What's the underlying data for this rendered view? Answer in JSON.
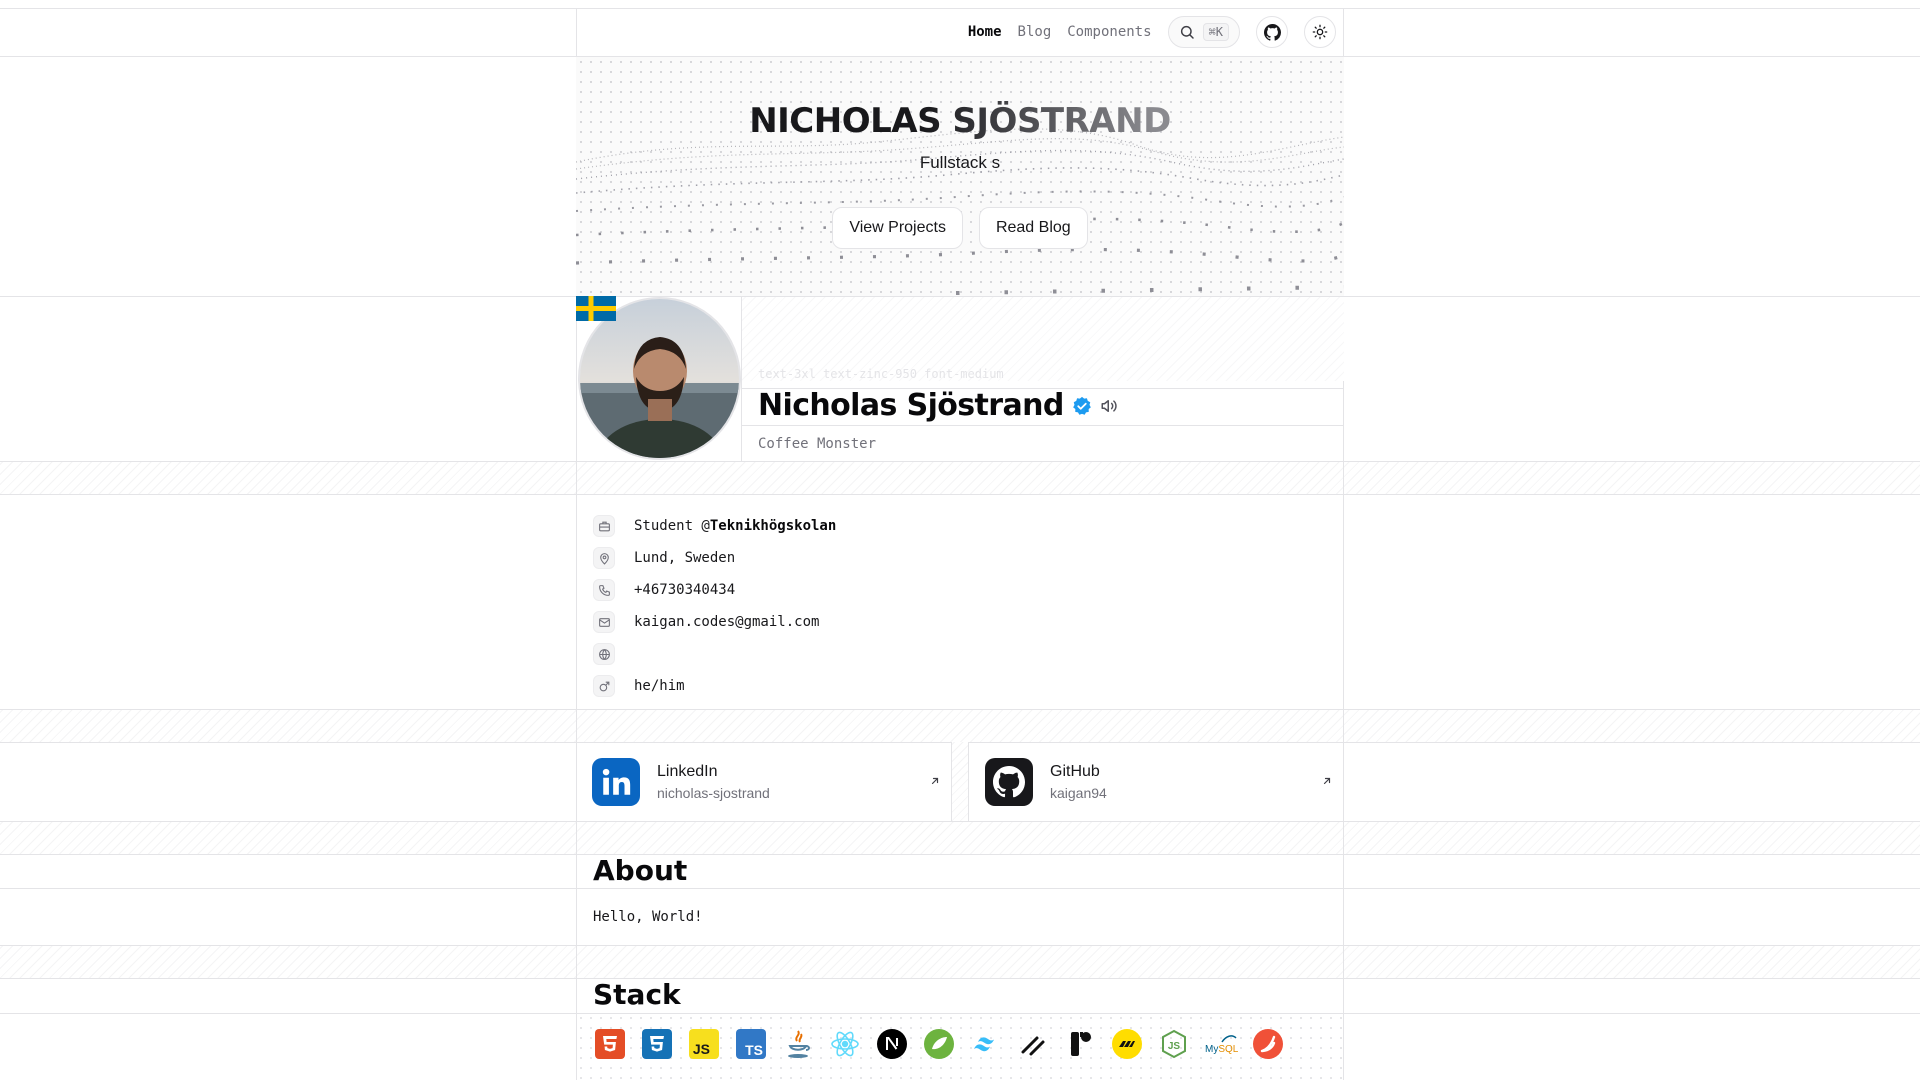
{
  "nav": {
    "links": [
      {
        "label": "Home",
        "active": true
      },
      {
        "label": "Blog",
        "active": false
      },
      {
        "label": "Components",
        "active": false
      }
    ],
    "search_shortcut": "⌘K"
  },
  "hero": {
    "title": "NICHOLAS SJÖSTRAND",
    "subtitle": "Fullstack s",
    "buttons": [
      "View Projects",
      "Read Blog"
    ]
  },
  "profile": {
    "ghost_classes": "text-3xl text-zinc-950 font-medium",
    "name": "Nicholas Sjöstrand",
    "tagline": "Coffee Monster",
    "flag": "sweden-flag"
  },
  "info": {
    "job_prefix": "Student @",
    "job_org": "Teknikhögskolan",
    "location": "Lund, Sweden",
    "phone": "+46730340434",
    "email": "kaigan.codes@gmail.com",
    "website": "",
    "pronouns": "he/him"
  },
  "social": [
    {
      "title": "LinkedIn",
      "handle": "nicholas-sjostrand",
      "icon": "linkedin-icon",
      "color": "#0a66c2"
    },
    {
      "title": "GitHub",
      "handle": "kaigan94",
      "icon": "github-icon",
      "color": "#18181b"
    }
  ],
  "about": {
    "heading": "About",
    "body": "Hello, World!"
  },
  "stack": {
    "heading": "Stack",
    "items": [
      "HTML5",
      "CSS3",
      "JavaScript",
      "TypeScript",
      "Java",
      "React",
      "Next.js",
      "Spring",
      "Tailwind CSS",
      "Motion",
      "Framer",
      "Postman",
      "Node.js",
      "MySQL",
      "Swift"
    ]
  }
}
